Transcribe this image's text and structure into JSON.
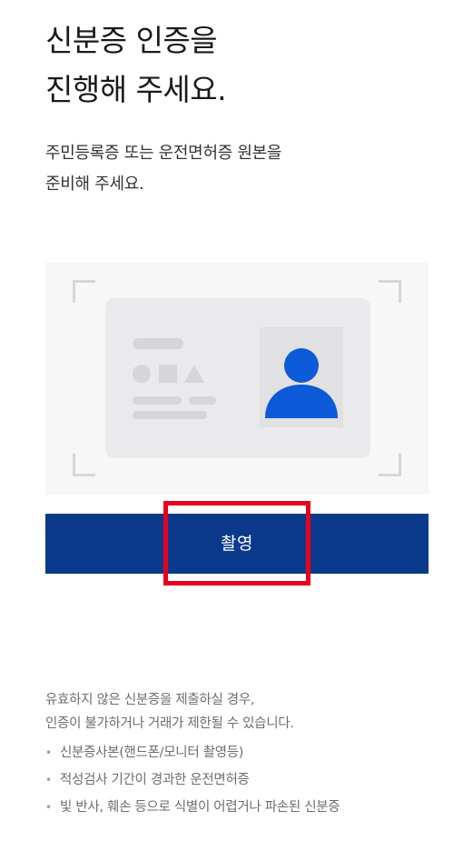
{
  "header": {
    "title_line1": "신분증 인증을",
    "title_line2": "진행해 주세요.",
    "subtitle_line1": "주민등록증 또는 운전면허증 원본을",
    "subtitle_line2": "준비해 주세요."
  },
  "illustration": {
    "icon": "id-card-illustration",
    "person_icon": "person-silhouette-icon",
    "person_color": "#0c5ad8",
    "card_color": "#eaeaec",
    "background_color": "#f7f7f8"
  },
  "capture": {
    "button_label": "촬영",
    "button_color": "#0b3a8c",
    "highlight_color": "#e8001c"
  },
  "notice": {
    "intro_line1": "유효하지 않은 신분증을 제출하실 경우,",
    "intro_line2": "인증이 불가하거나 거래가 제한될 수 있습니다.",
    "items": [
      "신분증사본(핸드폰/모니터 촬영등)",
      "적성검사 기간이 경과한 운전면허증",
      "빛 반사, 훼손 등으로 식별이 어렵거나 파손된 신분증"
    ],
    "bullet": "•"
  }
}
